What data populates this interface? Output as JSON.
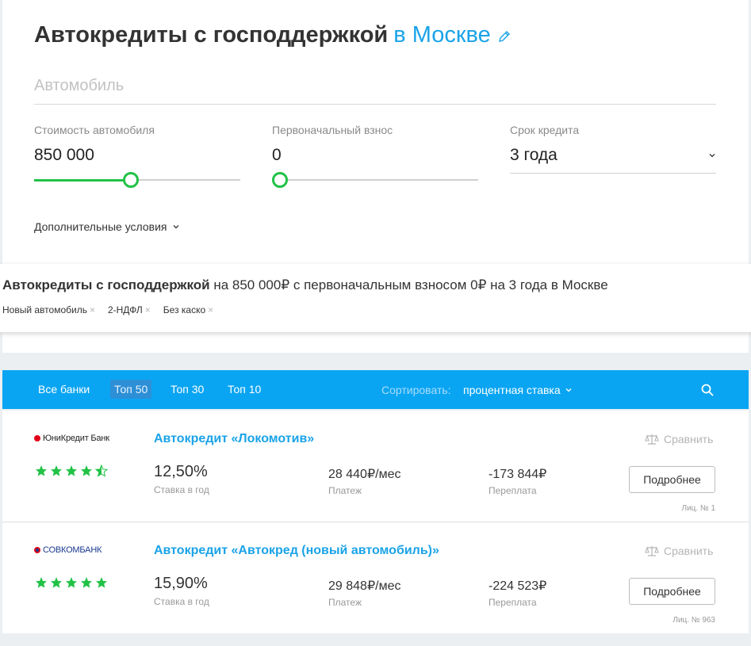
{
  "header": {
    "title": "Автокредиты с господдержкой",
    "city": "в Москве",
    "edit_icon": "pencil-icon"
  },
  "car_field": {
    "placeholder": "Автомобиль",
    "value": ""
  },
  "fields": {
    "price": {
      "label": "Стоимость автомобиля",
      "value": "850 000",
      "slider_level": 0.47
    },
    "downpayment": {
      "label": "Первоначальный взнос",
      "value": "0",
      "slider_level": 0.0
    },
    "term": {
      "label": "Срок кредита",
      "value": "3 года"
    }
  },
  "extra_conditions": "Дополнительные условия",
  "summary": {
    "bold": "Автокредиты с господдержкой",
    "rest": " на 850 000₽ с первоначальным взносом 0₽ на 3 года в Москве",
    "tags": [
      "Новый автомобиль",
      "2-НДФЛ",
      "Без каско"
    ]
  },
  "toolbar": {
    "tabs": [
      "Все банки",
      "Топ 50",
      "Топ 30",
      "Топ 10"
    ],
    "active_tab": "Топ 50",
    "sort_label": "Сортировать:",
    "sort_value": "процентная ставка"
  },
  "offers": [
    {
      "bank": "ЮниКредит Банк",
      "bank_color": "#e2001a",
      "rating": 4.5,
      "name": "Автокредит «Локомотив»",
      "rate": "12,50%",
      "rate_label": "Ставка в год",
      "payment": "28 440₽/мес",
      "payment_label": "Платеж",
      "overpay": "-173 844₽",
      "overpay_label": "Переплата",
      "compare": "Сравнить",
      "button": "Подробнее",
      "license": "Лиц. № 1"
    },
    {
      "bank": "СОВКОМБАНК",
      "bank_color": "#e30613",
      "rating": 5,
      "name": "Автокредит «Автокред (новый автомобиль)»",
      "rate": "15,90%",
      "rate_label": "Ставка в год",
      "payment": "29 848₽/мес",
      "payment_label": "Платеж",
      "overpay": "-224 523₽",
      "overpay_label": "Переплата",
      "compare": "Сравнить",
      "button": "Подробнее",
      "license": "Лиц. № 963"
    }
  ],
  "colors": {
    "accent": "#1aa3e8",
    "toolbar": "#0aa5f2",
    "green": "#21c246"
  }
}
